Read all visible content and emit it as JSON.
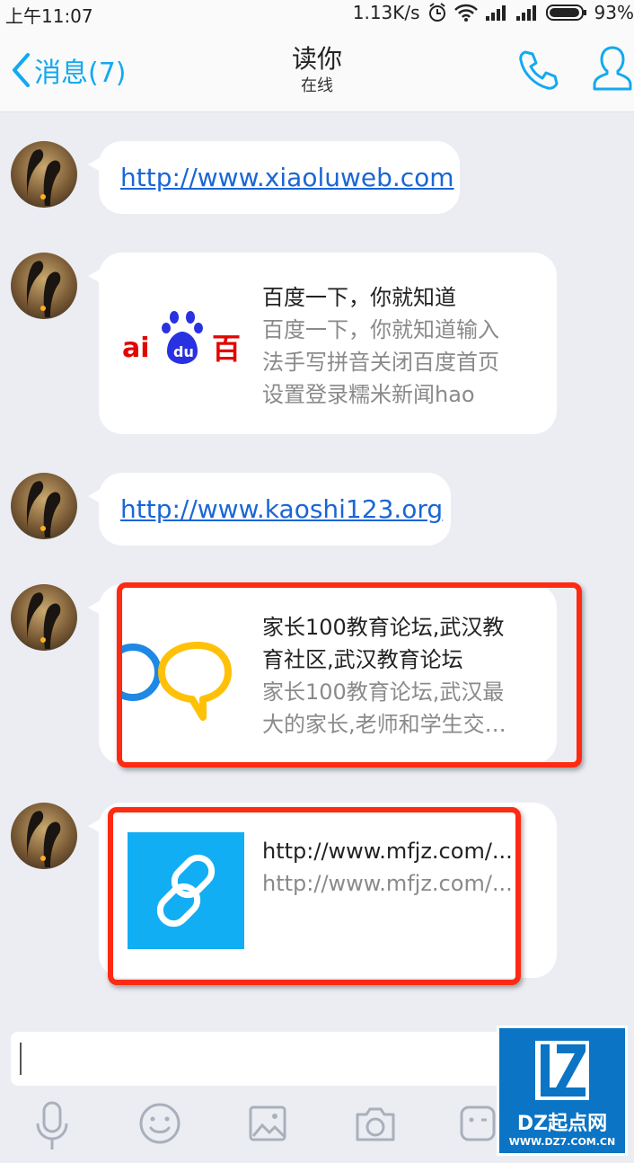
{
  "status_bar": {
    "time": "上午11:07",
    "speed": "1.13K/s",
    "battery": "93%"
  },
  "header": {
    "back_label": "消息(7)",
    "title": "读你",
    "subtitle": "在线"
  },
  "messages": [
    {
      "type": "link",
      "text": "http://www.xiaoluweb.com"
    },
    {
      "type": "card",
      "thumb_text": "ai du 百",
      "title": "百度一下，你就知道",
      "desc_lines": [
        "百度一下，你就知道输入",
        "法手写拼音关闭百度首页",
        "设置登录糯米新闻hao"
      ]
    },
    {
      "type": "link",
      "text": "http://www.kaoshi123.org"
    },
    {
      "type": "card",
      "title_lines": [
        "家长100教育论坛,武汉教",
        "育社区,武汉教育论坛"
      ],
      "desc_lines": [
        "家长100教育论坛,武汉最",
        "大的家长,老师和学生交…"
      ]
    },
    {
      "type": "card",
      "title": "http://www.mfjz.com/...",
      "desc": "http://www.mfjz.com/..."
    }
  ],
  "toolbar": [
    "microphone-icon",
    "emoji-icon",
    "image-icon",
    "camera-icon",
    "sticker-icon"
  ],
  "watermark": {
    "name": "DZ起点网",
    "url": "WWW.DZ7.COM.CN"
  },
  "colors": {
    "accent": "#12a9f0",
    "highlight": "#ff2a12",
    "link": "#1a66d6"
  }
}
